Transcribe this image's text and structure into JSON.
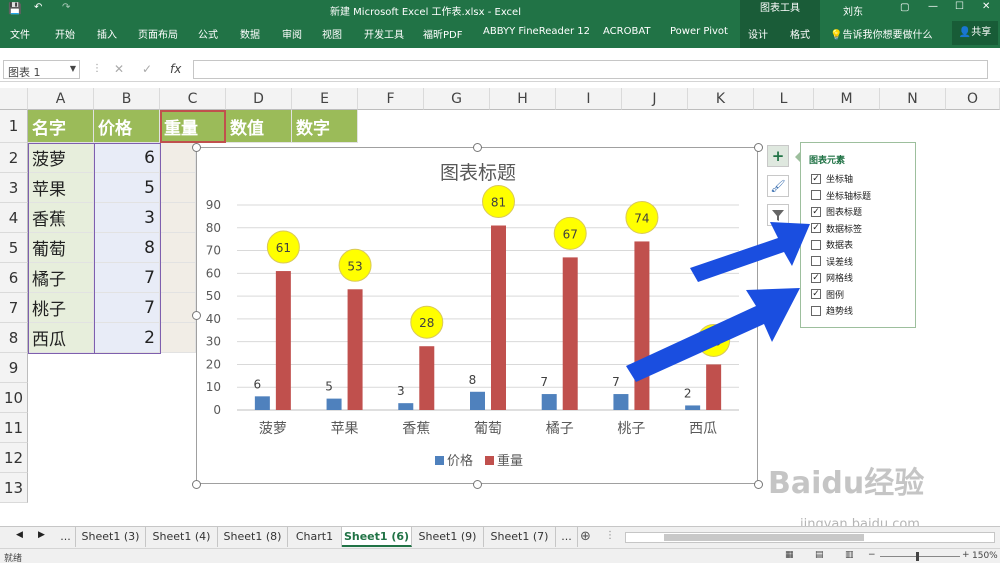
{
  "titlebar": {
    "title": "新建 Microsoft Excel 工作表.xlsx  -  Excel",
    "context_group": "图表工具",
    "user": "刘东"
  },
  "ribbon": {
    "tabs": [
      "文件",
      "开始",
      "插入",
      "页面布局",
      "公式",
      "数据",
      "审阅",
      "视图",
      "开发工具",
      "福昕PDF",
      "ABBYY FineReader 12",
      "ACROBAT",
      "Power Pivot",
      "设计",
      "格式"
    ],
    "tell_me": "告诉我你想要做什么",
    "share": "共享"
  },
  "formula_bar": {
    "name_box": "图表 1",
    "fx": "fx",
    "value": ""
  },
  "columns": [
    "A",
    "B",
    "C",
    "D",
    "E",
    "F",
    "G",
    "H",
    "I",
    "J",
    "K",
    "L",
    "M",
    "N",
    "O"
  ],
  "rows": [
    "1",
    "2",
    "3",
    "4",
    "5",
    "6",
    "7",
    "8",
    "9",
    "10",
    "11",
    "12",
    "13"
  ],
  "table": {
    "headers": [
      "名字",
      "价格",
      "重量",
      "数值",
      "数字"
    ],
    "names": [
      "菠萝",
      "苹果",
      "香蕉",
      "葡萄",
      "橘子",
      "桃子",
      "西瓜"
    ],
    "prices": [
      "6",
      "5",
      "3",
      "8",
      "7",
      "7",
      "2"
    ]
  },
  "chart_data": {
    "type": "bar",
    "title": "图表标题",
    "categories": [
      "菠萝",
      "苹果",
      "香蕉",
      "葡萄",
      "橘子",
      "桃子",
      "西瓜"
    ],
    "series": [
      {
        "name": "价格",
        "values": [
          6,
          5,
          3,
          8,
          7,
          7,
          2
        ],
        "color": "#4f81bd"
      },
      {
        "name": "重量",
        "values": [
          61,
          53,
          28,
          81,
          67,
          74,
          20
        ],
        "color": "#c0504d"
      }
    ],
    "ylim": [
      0,
      90
    ],
    "yticks": [
      0,
      10,
      20,
      30,
      40,
      50,
      60,
      70,
      80,
      90
    ],
    "grid": true,
    "legend": "bottom",
    "data_labels": [
      "6",
      "61",
      "5",
      "53",
      "3",
      "28",
      "8",
      "81",
      "7",
      "67",
      "7",
      "74",
      "2",
      "20"
    ]
  },
  "chart_elements": {
    "title": "图表元素",
    "items": [
      {
        "label": "坐标轴",
        "checked": true
      },
      {
        "label": "坐标轴标题",
        "checked": false
      },
      {
        "label": "图表标题",
        "checked": true
      },
      {
        "label": "数据标签",
        "checked": true
      },
      {
        "label": "数据表",
        "checked": false
      },
      {
        "label": "误差线",
        "checked": false
      },
      {
        "label": "网格线",
        "checked": true
      },
      {
        "label": "图例",
        "checked": true
      },
      {
        "label": "趋势线",
        "checked": false
      }
    ]
  },
  "side_buttons": {
    "add": "+",
    "style": "brush-icon",
    "filter": "filter-icon"
  },
  "sheet_tabs": [
    "...",
    "Sheet1 (3)",
    "Sheet1 (4)",
    "Sheet1 (8)",
    "Chart1",
    "Sheet1 (6)",
    "Sheet1 (9)",
    "Sheet1 (7)",
    "..."
  ],
  "active_sheet": "Sheet1 (6)",
  "status": {
    "left": "就绪",
    "zoom": "150%"
  },
  "watermark": {
    "line1": "Baidu经验",
    "line2": "jingyan.baidu.com"
  },
  "accent_color": "#217346",
  "arrow_color": "#1a4ee0"
}
